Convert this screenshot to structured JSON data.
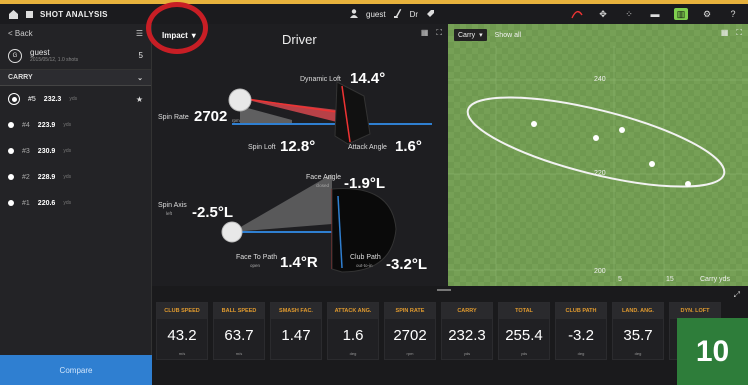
{
  "topbar": {
    "title": "SHOT ANALYSIS",
    "user": "guest",
    "club": "Dr"
  },
  "sidebar": {
    "back": "< Back",
    "user_name": "guest",
    "user_sub": "2015/05/12, 1.0 shots",
    "user_count": "5",
    "section": "CARRY",
    "shots": [
      {
        "num": "#5",
        "value": "232.3",
        "unit": "yds",
        "selected": true
      },
      {
        "num": "#4",
        "value": "223.9",
        "unit": "yds",
        "selected": false
      },
      {
        "num": "#3",
        "value": "230.9",
        "unit": "yds",
        "selected": false
      },
      {
        "num": "#2",
        "value": "228.9",
        "unit": "yds",
        "selected": false
      },
      {
        "num": "#1",
        "value": "220.6",
        "unit": "yds",
        "selected": false
      }
    ],
    "compare": "Compare"
  },
  "impact": {
    "dropdown": "Impact",
    "title": "Driver",
    "dynamic_loft_label": "Dynamic Loft",
    "dynamic_loft": "14.4°",
    "spin_rate_label": "Spin Rate",
    "spin_rate": "2702",
    "spin_rate_unit": "rpm",
    "spin_loft_label": "Spin Loft",
    "spin_loft": "12.8°",
    "attack_angle_label": "Attack Angle",
    "attack_angle": "1.6°",
    "face_angle_label": "Face Angle",
    "face_angle_sub": "closed",
    "face_angle": "-1.9°L",
    "spin_axis_label": "Spin Axis",
    "spin_axis_sub": "left",
    "spin_axis": "-2.5°L",
    "face_to_path_label": "Face To Path",
    "face_to_path_sub": "open",
    "face_to_path": "1.4°R",
    "club_path_label": "Club Path",
    "club_path_sub": "out-to-in",
    "club_path": "-3.2°L"
  },
  "dispersion": {
    "dropdown": "Carry",
    "show_all": "Show all",
    "y_ticks": [
      "240",
      "220",
      "200"
    ],
    "x_ticks": [
      "5",
      "15"
    ],
    "axis_unit": "Carry yds"
  },
  "metrics": [
    {
      "label": "CLUB SPEED",
      "value": "43.2",
      "unit": "m/s"
    },
    {
      "label": "BALL SPEED",
      "value": "63.7",
      "unit": "m/s"
    },
    {
      "label": "SMASH FAC.",
      "value": "1.47",
      "unit": ""
    },
    {
      "label": "ATTACK ANG.",
      "value": "1.6",
      "unit": "deg"
    },
    {
      "label": "SPIN RATE",
      "value": "2702",
      "unit": "rpm"
    },
    {
      "label": "CARRY",
      "value": "232.3",
      "unit": "yds"
    },
    {
      "label": "TOTAL",
      "value": "255.4",
      "unit": "yds"
    },
    {
      "label": "CLUB PATH",
      "value": "-3.2",
      "unit": "deg"
    },
    {
      "label": "LAND. ANG.",
      "value": "35.7",
      "unit": "deg"
    },
    {
      "label": "DYN. LOFT",
      "value": "",
      "unit": ""
    }
  ],
  "badge": "10",
  "colors": {
    "accent_gold": "#e7b23c",
    "highlight_ring": "#c81e25",
    "metric_header": "#e09a2e",
    "compare": "#2f7fd1",
    "grass": "#6f9950"
  }
}
